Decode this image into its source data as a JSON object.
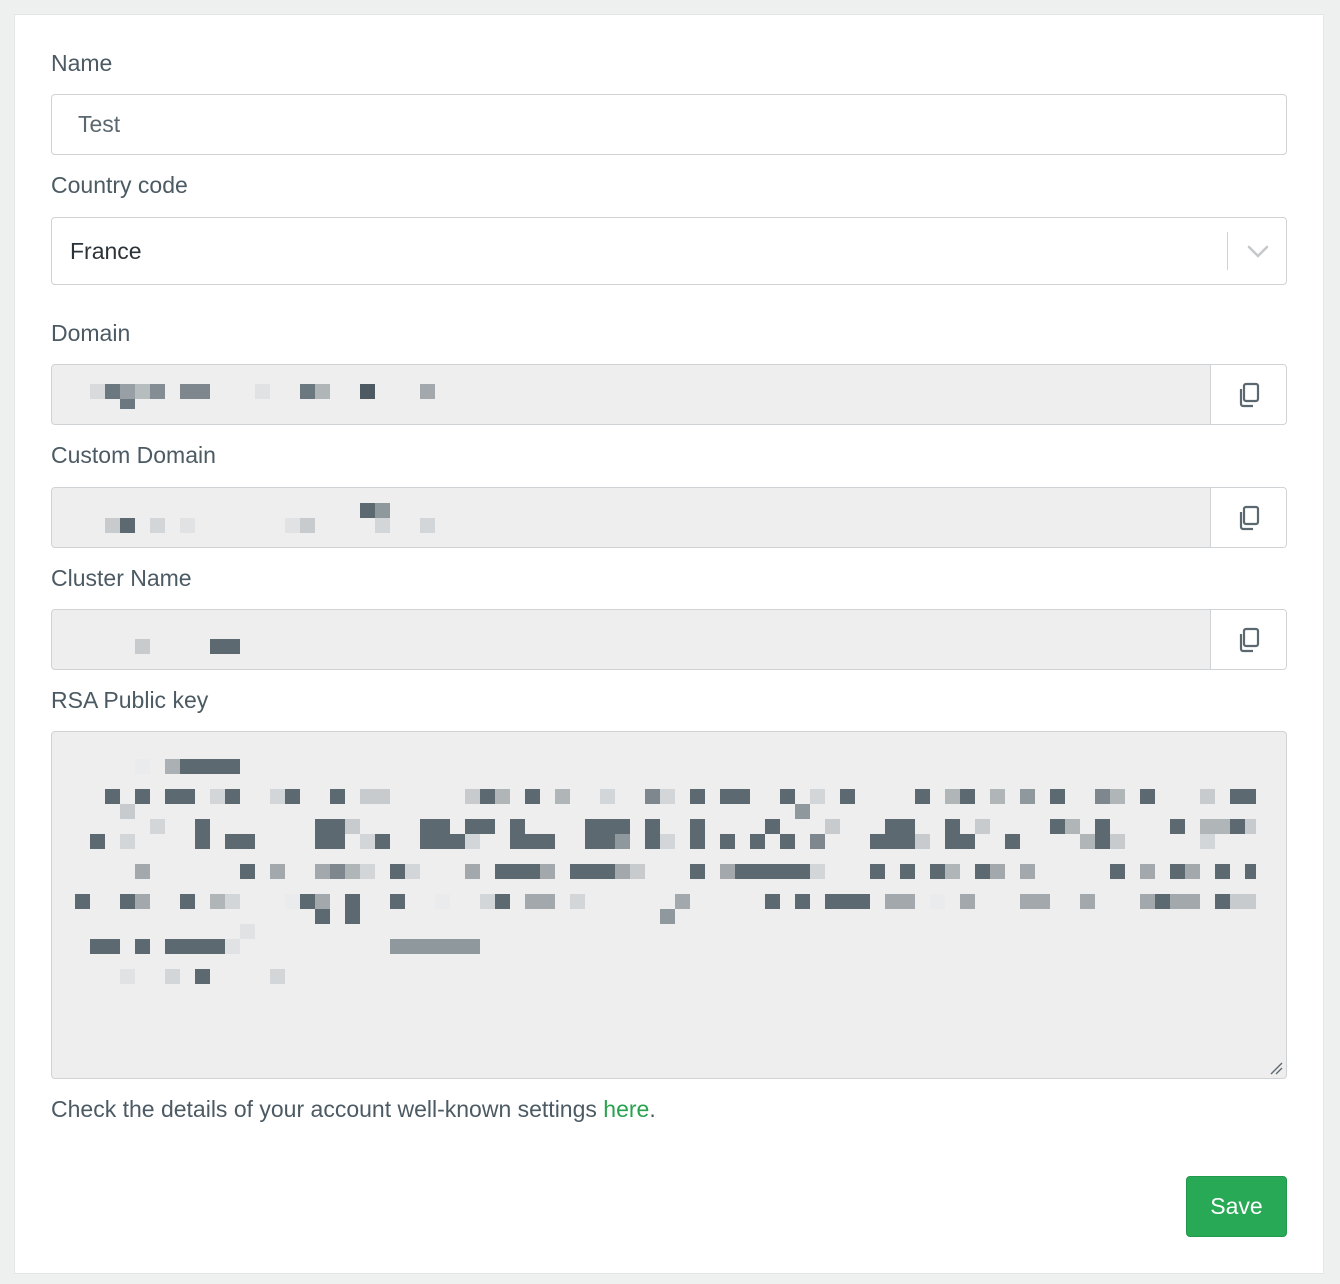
{
  "form": {
    "name": {
      "label": "Name",
      "value": "Test"
    },
    "country_code": {
      "label": "Country code",
      "selected": "France"
    },
    "domain": {
      "label": "Domain",
      "copy_icon": "copy-icon"
    },
    "custom_domain": {
      "label": "Custom Domain",
      "copy_icon": "copy-icon"
    },
    "cluster_name": {
      "label": "Cluster Name",
      "copy_icon": "copy-icon"
    },
    "rsa_public_key": {
      "label": "RSA Public key"
    },
    "help": {
      "text": "Check the details of your account well-known settings ",
      "link": "here",
      "suffix": "."
    },
    "save_label": "Save"
  },
  "colors": {
    "accent": "#28a956",
    "link": "#27a24f",
    "readonly_bg": "#eeeeee",
    "border": "#cfd3d6"
  }
}
